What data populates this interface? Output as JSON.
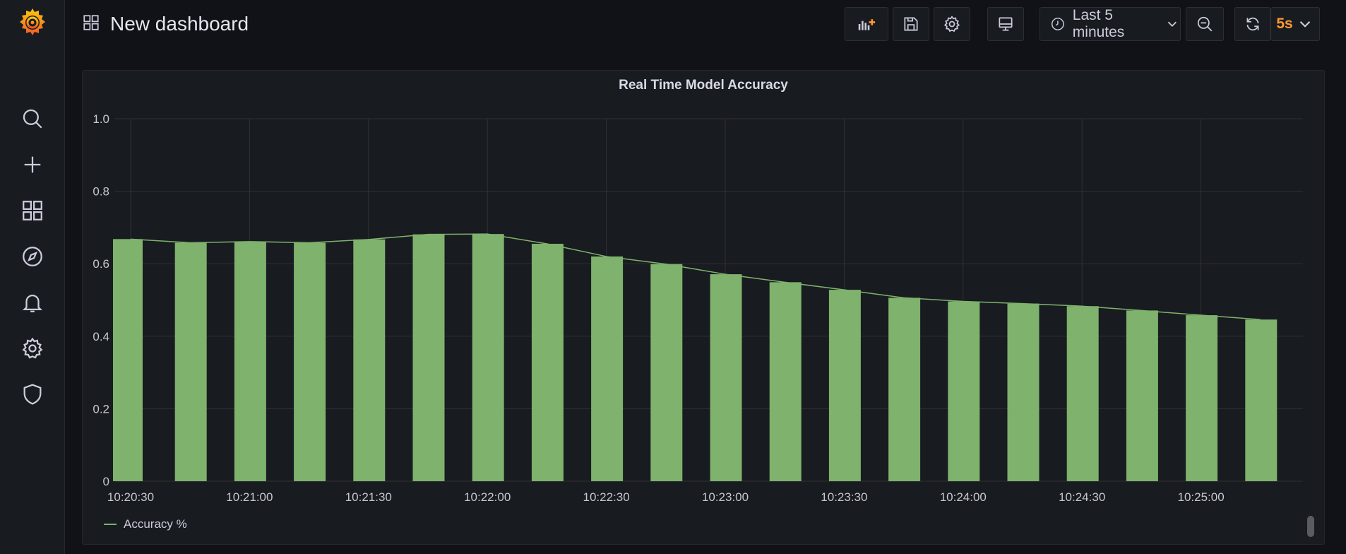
{
  "app": {
    "colors": {
      "background": "#111217",
      "panel": "#181b1f",
      "accent": "#ff9830",
      "series": "#7eb26d"
    }
  },
  "sidebar": {
    "items": [
      {
        "icon": "search-icon"
      },
      {
        "icon": "plus-icon"
      },
      {
        "icon": "dashboards-icon"
      },
      {
        "icon": "compass-icon"
      },
      {
        "icon": "bell-icon"
      },
      {
        "icon": "gear-icon"
      },
      {
        "icon": "shield-icon"
      }
    ]
  },
  "header": {
    "title": "New dashboard",
    "time_range": "Last 5 minutes",
    "refresh_interval": "5s"
  },
  "panel": {
    "title": "Real Time Model Accuracy",
    "legend": "Accuracy %"
  },
  "chart_data": {
    "type": "bar",
    "title": "Real Time Model Accuracy",
    "xlabel": "",
    "ylabel": "",
    "ylim": [
      0,
      1.0
    ],
    "y_ticks": [
      "0",
      "0.2",
      "0.4",
      "0.6",
      "0.8",
      "1.0"
    ],
    "x_ticks": [
      "10:20:30",
      "10:21:00",
      "10:21:30",
      "10:22:00",
      "10:22:30",
      "10:23:00",
      "10:23:30",
      "10:24:00",
      "10:24:30",
      "10:25:00"
    ],
    "categories": [
      "10:20:30",
      "10:20:45",
      "10:21:00",
      "10:21:15",
      "10:21:30",
      "10:21:45",
      "10:22:00",
      "10:22:15",
      "10:22:30",
      "10:22:45",
      "10:23:00",
      "10:23:15",
      "10:23:30",
      "10:23:45",
      "10:24:00",
      "10:24:15",
      "10:24:30",
      "10:24:45",
      "10:25:00",
      "10:25:15"
    ],
    "series": [
      {
        "name": "Accuracy %",
        "values": [
          0.668,
          0.658,
          0.661,
          0.658,
          0.667,
          0.681,
          0.682,
          0.655,
          0.62,
          0.599,
          0.571,
          0.549,
          0.528,
          0.506,
          0.496,
          0.49,
          0.483,
          0.471,
          0.458,
          0.446
        ]
      }
    ],
    "grid": true,
    "legend_position": "bottom-left"
  }
}
